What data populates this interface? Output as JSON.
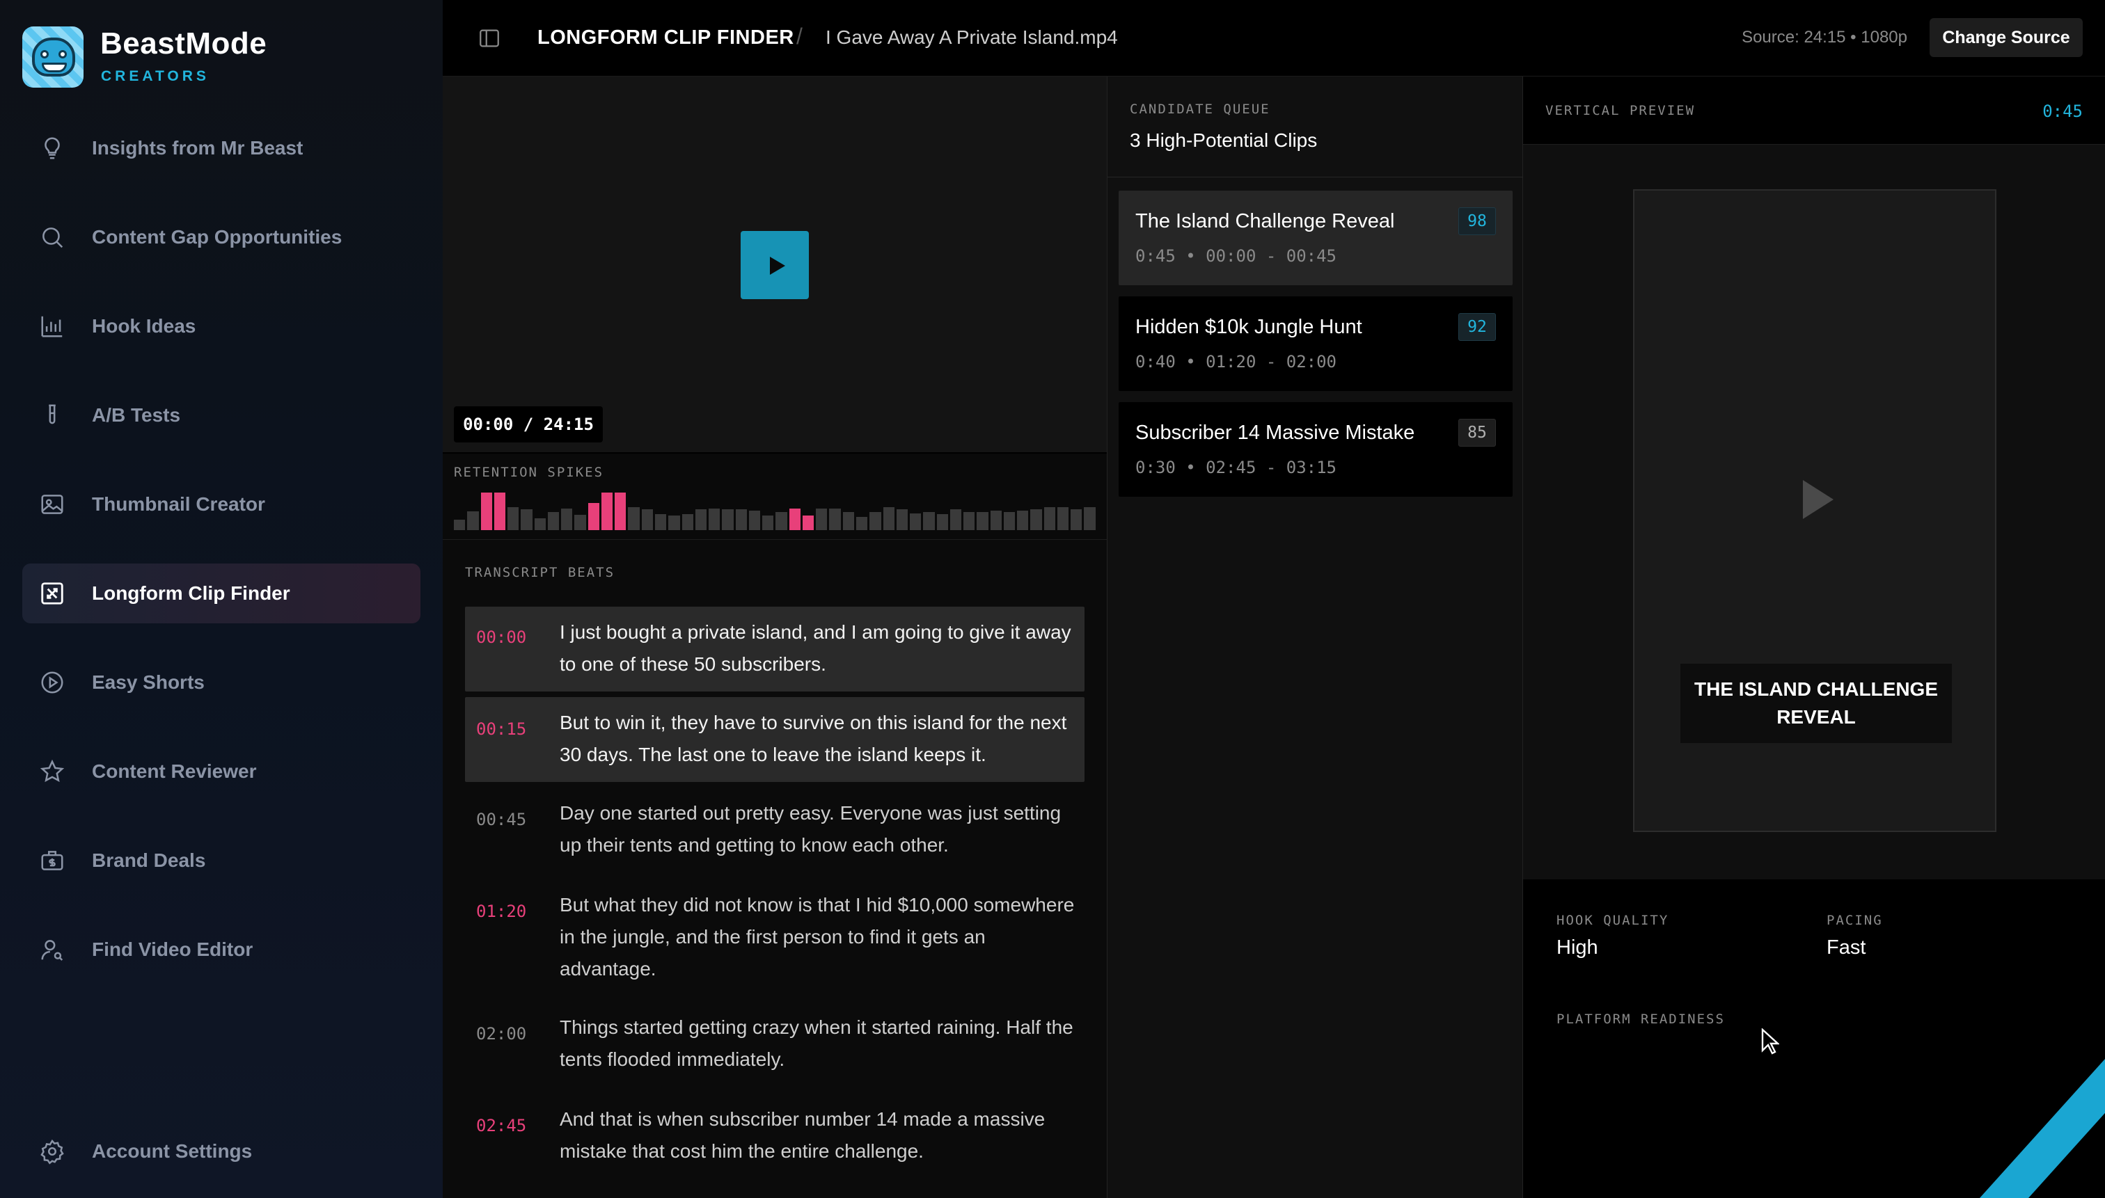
{
  "brand": {
    "name": "BeastMode",
    "sub": "CREATORS"
  },
  "nav": [
    {
      "label": "Insights from Mr Beast",
      "icon": "lightbulb-icon"
    },
    {
      "label": "Content Gap Opportunities",
      "icon": "search-icon"
    },
    {
      "label": "Hook Ideas",
      "icon": "chart-icon"
    },
    {
      "label": "A/B Tests",
      "icon": "flask-icon"
    },
    {
      "label": "Thumbnail Creator",
      "icon": "image-icon"
    },
    {
      "label": "Longform Clip Finder",
      "icon": "shuffle-icon",
      "active": true
    },
    {
      "label": "Easy Shorts",
      "icon": "play-circle-icon"
    },
    {
      "label": "Content Reviewer",
      "icon": "star-icon"
    },
    {
      "label": "Brand Deals",
      "icon": "briefcase-dollar-icon"
    },
    {
      "label": "Find Video Editor",
      "icon": "user-search-icon"
    }
  ],
  "account": {
    "label": "Account Settings",
    "icon": "gear-icon"
  },
  "header": {
    "title": "LONGFORM CLIP FINDER",
    "separator": "/",
    "file": "I Gave Away A Private Island.mp4",
    "source": "Source: 24:15 • 1080p",
    "change_source": "Change Source"
  },
  "player": {
    "time": "00:00 / 24:15"
  },
  "retention": {
    "label": "RETENTION SPIKES",
    "levels": [
      0.28,
      0.5,
      1,
      1,
      0.62,
      0.55,
      0.32,
      0.48,
      0.58,
      0.4,
      0.72,
      1,
      1,
      0.62,
      0.55,
      0.42,
      0.38,
      0.42,
      0.55,
      0.58,
      0.55,
      0.55,
      0.52,
      0.38,
      0.48,
      0.58,
      0.38,
      0.58,
      0.58,
      0.48,
      0.35,
      0.48,
      0.62,
      0.55,
      0.45,
      0.48,
      0.42,
      0.55,
      0.48,
      0.48,
      0.52,
      0.48,
      0.52,
      0.55,
      0.62,
      0.62,
      0.55,
      0.62
    ],
    "hot": [
      2,
      3,
      10,
      11,
      12,
      25,
      26
    ],
    "colors": {
      "hot": "#e8407a",
      "base": "#3a3a3a"
    }
  },
  "transcript": {
    "label": "TRANSCRIPT BEATS",
    "beats": [
      {
        "time": "00:00",
        "text": "I just bought a private island, and I am going to give it away to one of these 50 subscribers."
      },
      {
        "time": "00:15",
        "text": "But to win it, they have to survive on this island for the next 30 days. The last one to leave the island keeps it."
      },
      {
        "time": "00:45",
        "text": "Day one started out pretty easy. Everyone was just setting up their tents and getting to know each other."
      },
      {
        "time": "01:20",
        "text": "But what they did not know is that I hid $10,000 somewhere in the jungle, and the first person to find it gets an advantage."
      },
      {
        "time": "02:00",
        "text": "Things started getting crazy when it started raining. Half the tents flooded immediately."
      },
      {
        "time": "02:45",
        "text": "And that is when subscriber number 14 made a massive mistake that cost him the entire challenge."
      }
    ]
  },
  "queue": {
    "label": "CANDIDATE QUEUE",
    "title": "3 High-Potential Clips",
    "clips": [
      {
        "title": "The Island Challenge Reveal",
        "meta": "0:45  •  00:00 - 00:45",
        "score": "98"
      },
      {
        "title": "Hidden $10k Jungle Hunt",
        "meta": "0:40  •  01:20 - 02:00",
        "score": "92"
      },
      {
        "title": "Subscriber 14 Massive Mistake",
        "meta": "0:30  •  02:45 - 03:15",
        "score": "85"
      }
    ]
  },
  "preview": {
    "label": "VERTICAL PREVIEW",
    "duration": "0:45",
    "caption": "THE ISLAND CHALLENGE REVEAL",
    "hook_label": "HOOK QUALITY",
    "hook_value": "High",
    "pacing_label": "PACING",
    "pacing_value": "Fast",
    "readiness_label": "PLATFORM READINESS"
  },
  "colors": {
    "accent": "#22b5dd",
    "pink": "#e8407a"
  }
}
